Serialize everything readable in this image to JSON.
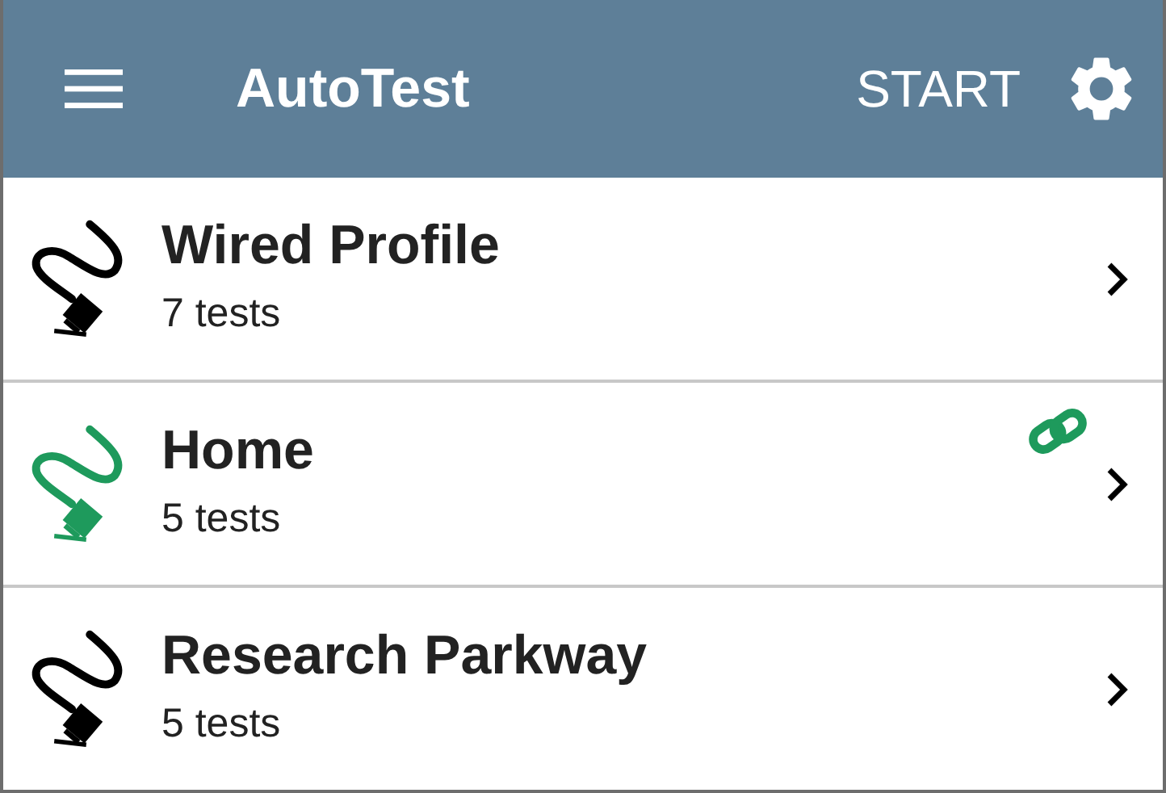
{
  "app_bar": {
    "title": "AutoTest",
    "action": "START"
  },
  "profiles": [
    {
      "name": "Wired Profile",
      "tests": "7 tests",
      "active": false,
      "linked": false
    },
    {
      "name": "Home",
      "tests": "5 tests",
      "active": true,
      "linked": true
    },
    {
      "name": "Research Parkway",
      "tests": "5 tests",
      "active": false,
      "linked": false
    }
  ]
}
